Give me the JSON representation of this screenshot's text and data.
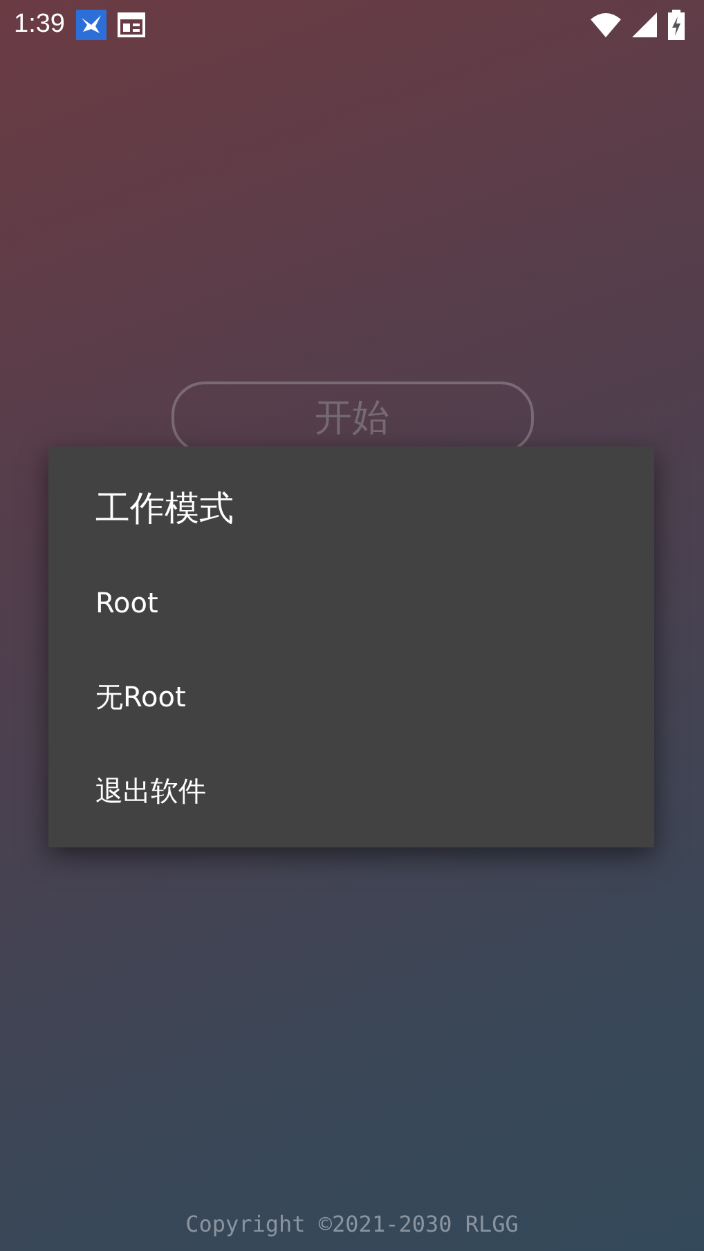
{
  "status_bar": {
    "time": "1:39"
  },
  "start_button": {
    "label": "开始"
  },
  "dialog": {
    "title": "工作模式",
    "items": [
      {
        "label": "Root"
      },
      {
        "label": "无Root"
      },
      {
        "label": "退出软件"
      }
    ]
  },
  "footer": {
    "copyright": "Copyright ©2021-2030 RLGG"
  }
}
